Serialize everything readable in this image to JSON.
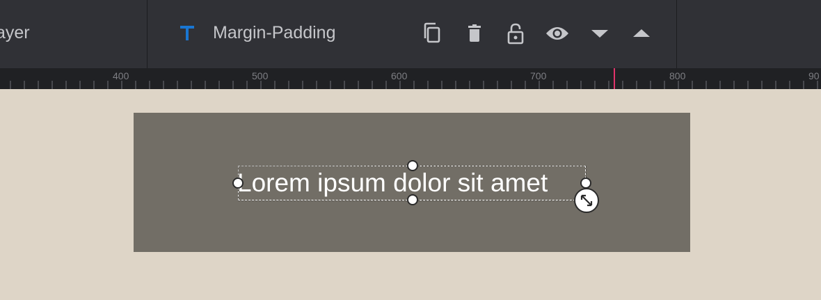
{
  "toolbar": {
    "layer_label": "ayer",
    "layer_name": "Margin-Padding",
    "type_icon": "text-type-icon",
    "type_icon_color": "#1976d2",
    "actions": [
      {
        "name": "duplicate-button",
        "icon": "copy-icon"
      },
      {
        "name": "delete-button",
        "icon": "trash-icon"
      },
      {
        "name": "lock-button",
        "icon": "unlock-icon"
      },
      {
        "name": "visibility-button",
        "icon": "eye-icon"
      },
      {
        "name": "move-down-button",
        "icon": "caret-down-icon"
      },
      {
        "name": "move-up-button",
        "icon": "caret-up-icon"
      }
    ]
  },
  "ruler": {
    "labels": [
      "400",
      "500",
      "600",
      "700",
      "800",
      "90"
    ],
    "marker_color": "#e2336b"
  },
  "canvas": {
    "background_color": "#ded5c7",
    "box_color": "#726e66",
    "selected_text": "Lorem ipsum dolor sit amet"
  }
}
